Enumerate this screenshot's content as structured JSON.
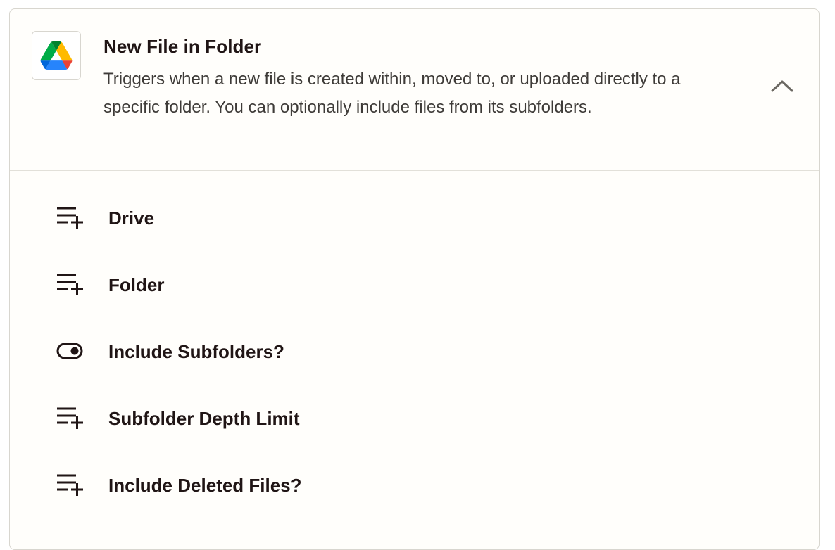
{
  "trigger": {
    "app_icon": "google-drive-logo",
    "title": "New File in Folder",
    "description": "Triggers when a new file is created within, moved to, or uploaded directly to a specific folder. You can optionally include files from its subfolders.",
    "collapse_icon": "chevron-up-icon"
  },
  "fields": [
    {
      "label": "Drive",
      "icon": "dropdown-field-icon"
    },
    {
      "label": "Folder",
      "icon": "dropdown-field-icon"
    },
    {
      "label": "Include Subfolders?",
      "icon": "toggle-icon"
    },
    {
      "label": "Subfolder Depth Limit",
      "icon": "dropdown-field-icon"
    },
    {
      "label": "Include Deleted Files?",
      "icon": "dropdown-field-icon"
    }
  ],
  "colors": {
    "card_bg": "#fffefb",
    "border": "#d8d6cf",
    "text_primary": "#201515",
    "text_secondary": "#3e3b38"
  }
}
